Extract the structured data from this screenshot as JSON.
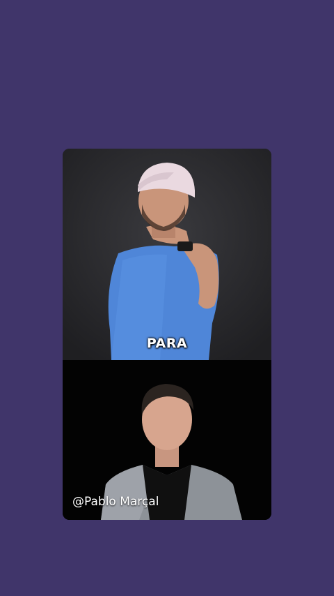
{
  "caption": {
    "text": "PARA"
  },
  "watermark": {
    "text": "@Pablo Marçal"
  },
  "colors": {
    "page_background": "#40356a",
    "top_panel_background": "#2b2b2e",
    "bottom_panel_background": "#030303",
    "caption_text": "#ffffff"
  }
}
